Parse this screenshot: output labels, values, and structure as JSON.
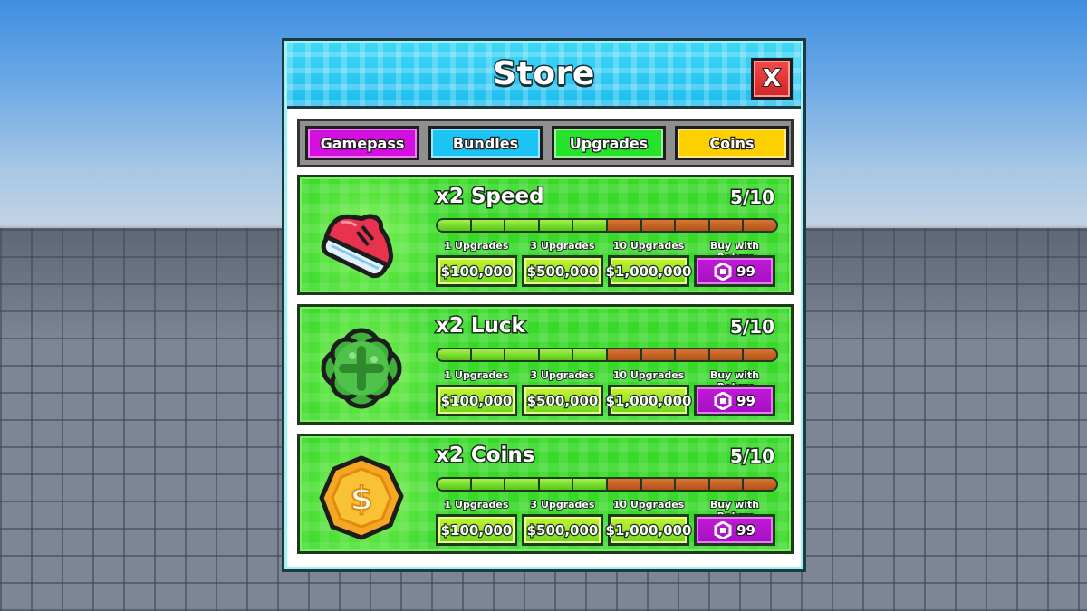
{
  "store": {
    "title": "Store",
    "close_label": "X"
  },
  "tabs": [
    {
      "label": "Gamepass",
      "color": "#d410e0"
    },
    {
      "label": "Bundles",
      "color": "#1cc4f4"
    },
    {
      "label": "Upgrades",
      "color": "#27e22b"
    },
    {
      "label": "Coins",
      "color": "#ffd000"
    }
  ],
  "option_labels": [
    "1 Upgrades",
    "3 Upgrades",
    "10 Upgrades",
    "Buy with Robux"
  ],
  "items": [
    {
      "name": "x2 Speed",
      "level": "5/10",
      "progress_filled": 5,
      "progress_total": 10,
      "icon": "shoe-icon",
      "prices": [
        "$100,000",
        "$500,000",
        "$1,000,000"
      ],
      "robux_price": "99"
    },
    {
      "name": "x2 Luck",
      "level": "5/10",
      "progress_filled": 5,
      "progress_total": 10,
      "icon": "clover-icon",
      "prices": [
        "$100,000",
        "$500,000",
        "$1,000,000"
      ],
      "robux_price": "99"
    },
    {
      "name": "x2 Coins",
      "level": "5/10",
      "progress_filled": 5,
      "progress_total": 10,
      "icon": "coin-icon",
      "prices": [
        "$100,000",
        "$500,000",
        "$1,000,000"
      ],
      "robux_price": "99"
    }
  ],
  "colors": {
    "header": "#1ebdf0",
    "card": "#39d92a",
    "progress_on": "#7fdc2e",
    "progress_off": "#c45e1b",
    "close": "#e03030",
    "robux_button": "#b514cc"
  }
}
